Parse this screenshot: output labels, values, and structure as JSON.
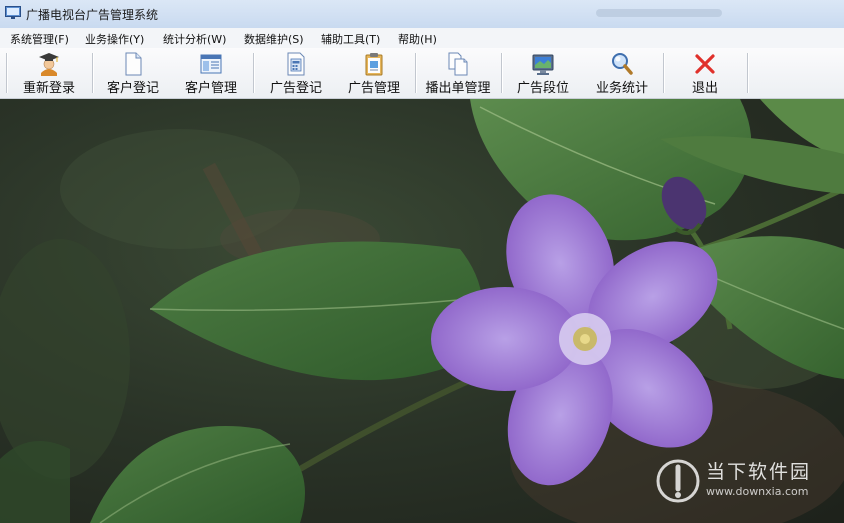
{
  "window": {
    "title": "广播电视台广告管理系统"
  },
  "menu": [
    {
      "label": "系统管理(F)"
    },
    {
      "label": "业务操作(Y)"
    },
    {
      "label": "统计分析(W)"
    },
    {
      "label": "数据维护(S)"
    },
    {
      "label": "辅助工具(T)"
    },
    {
      "label": "帮助(H)"
    }
  ],
  "toolbar": [
    {
      "label": "重新登录",
      "icon": "graduation-cap-user-icon"
    },
    {
      "label": "客户登记",
      "icon": "document-icon"
    },
    {
      "label": "客户管理",
      "icon": "list-window-icon"
    },
    {
      "label": "广告登记",
      "icon": "calculator-document-icon"
    },
    {
      "label": "广告管理",
      "icon": "clipboard-document-icon"
    },
    {
      "label": "播出单管理",
      "icon": "copy-documents-icon"
    },
    {
      "label": "广告段位",
      "icon": "monitor-icon"
    },
    {
      "label": "业务统计",
      "icon": "magnifier-icon"
    },
    {
      "label": "退出",
      "icon": "red-x-close-icon"
    }
  ],
  "watermark": {
    "name": "当下软件园",
    "url": "www.downxia.com"
  },
  "colors": {
    "titlebar": "#c9daf0",
    "menubar": "#f3f5f8",
    "toolbar": "#f3f5f8",
    "flower": "#8f62c8",
    "leaf": "#3f6d3a",
    "exit_red": "#e0312b"
  }
}
